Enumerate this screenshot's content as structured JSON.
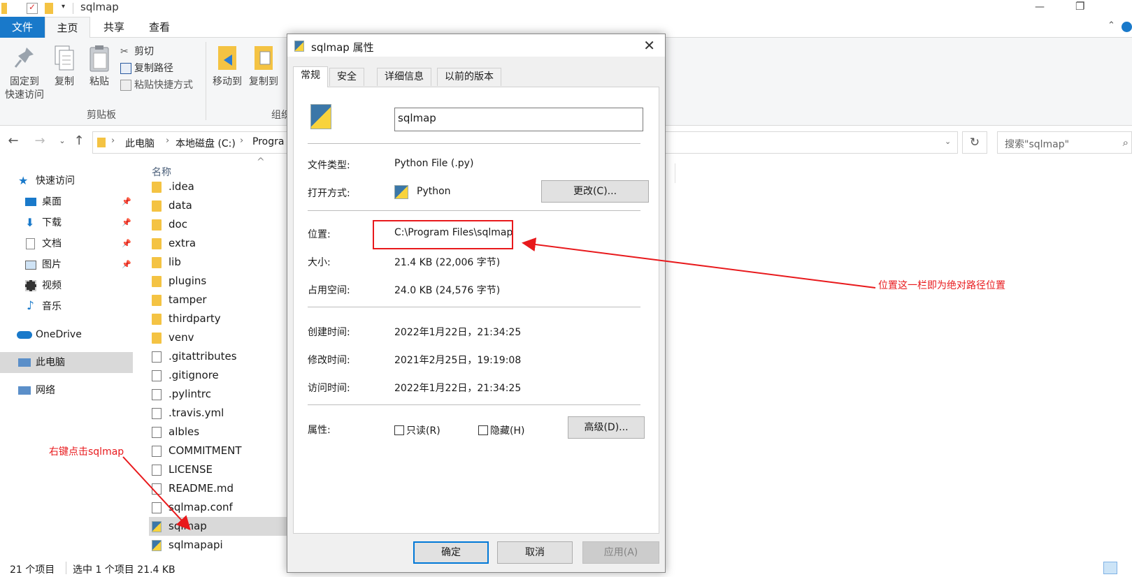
{
  "window": {
    "title": "sqlmap",
    "minimize_glyph": "—",
    "restore_glyph": "❐"
  },
  "ribbon_tabs": [
    "文件",
    "主页",
    "共享",
    "查看"
  ],
  "ribbon": {
    "pin_label_1": "固定到",
    "pin_label_2": "快速访问",
    "copy_label": "复制",
    "paste_label": "粘贴",
    "cut_label": "剪切",
    "copy_path_label": "复制路径",
    "paste_shortcut_label": "粘贴快捷方式",
    "clipboard_group": "剪贴板",
    "move_to_label": "移动到",
    "copy_to_label": "复制到",
    "organize_group_partial": "组织"
  },
  "address": {
    "crumbs": [
      "此电脑",
      "本地磁盘 (C:)",
      "Progra"
    ],
    "search_placeholder": "搜索\"sqlmap\""
  },
  "nav": {
    "quick_access": "快速访问",
    "items": [
      {
        "label": "桌面",
        "icon": "desktop-icon"
      },
      {
        "label": "下载",
        "icon": "download-icon"
      },
      {
        "label": "文档",
        "icon": "document-icon"
      },
      {
        "label": "图片",
        "icon": "picture-icon"
      },
      {
        "label": "视频",
        "icon": "video-icon"
      },
      {
        "label": "音乐",
        "icon": "music-icon"
      }
    ],
    "onedrive": "OneDrive",
    "this_pc": "此电脑",
    "network": "网络"
  },
  "filelist": {
    "column_name": "名称",
    "files": [
      {
        "name": ".idea",
        "type": "folder"
      },
      {
        "name": "data",
        "type": "folder"
      },
      {
        "name": "doc",
        "type": "folder"
      },
      {
        "name": "extra",
        "type": "folder"
      },
      {
        "name": "lib",
        "type": "folder"
      },
      {
        "name": "plugins",
        "type": "folder"
      },
      {
        "name": "tamper",
        "type": "folder"
      },
      {
        "name": "thirdparty",
        "type": "folder"
      },
      {
        "name": "venv",
        "type": "folder"
      },
      {
        "name": ".gitattributes",
        "type": "file"
      },
      {
        "name": ".gitignore",
        "type": "file"
      },
      {
        "name": ".pylintrc",
        "type": "file"
      },
      {
        "name": ".travis.yml",
        "type": "file"
      },
      {
        "name": "albles",
        "type": "file"
      },
      {
        "name": "COMMITMENT",
        "type": "file"
      },
      {
        "name": "LICENSE",
        "type": "file"
      },
      {
        "name": "README.md",
        "type": "file"
      },
      {
        "name": "sqlmap.conf",
        "type": "file"
      },
      {
        "name": "sqlmap",
        "type": "python",
        "selected": true
      },
      {
        "name": "sqlmapapi",
        "type": "python"
      }
    ]
  },
  "status": {
    "count": "21 个项目",
    "selection": "选中 1 个项目 21.4 KB"
  },
  "dialog": {
    "title": "sqlmap 属性",
    "tabs": [
      "常规",
      "安全",
      "详细信息",
      "以前的版本"
    ],
    "name": "sqlmap",
    "type_label": "文件类型:",
    "type_value": "Python File (.py)",
    "opens_label": "打开方式:",
    "opens_value": "Python",
    "change_button": "更改(C)...",
    "location_label": "位置:",
    "location_value": "C:\\Program Files\\sqlmap",
    "size_label": "大小:",
    "size_value": "21.4 KB (22,006 字节)",
    "disk_label": "占用空间:",
    "disk_value": "24.0 KB (24,576 字节)",
    "created_label": "创建时间:",
    "created_value": "2022年1月22日，21:34:25",
    "modified_label": "修改时间:",
    "modified_value": "2021年2月25日，19:19:08",
    "accessed_label": "访问时间:",
    "accessed_value": "2022年1月22日，21:34:25",
    "attr_label": "属性:",
    "readonly": "只读(R)",
    "hidden": "隐藏(H)",
    "advanced_button": "高级(D)...",
    "ok": "确定",
    "cancel": "取消",
    "apply": "应用(A)"
  },
  "annotations": {
    "right_click": "右键点击sqlmap",
    "location_note": "位置这一栏即为绝对路径位置",
    "color": "#e8191c"
  }
}
